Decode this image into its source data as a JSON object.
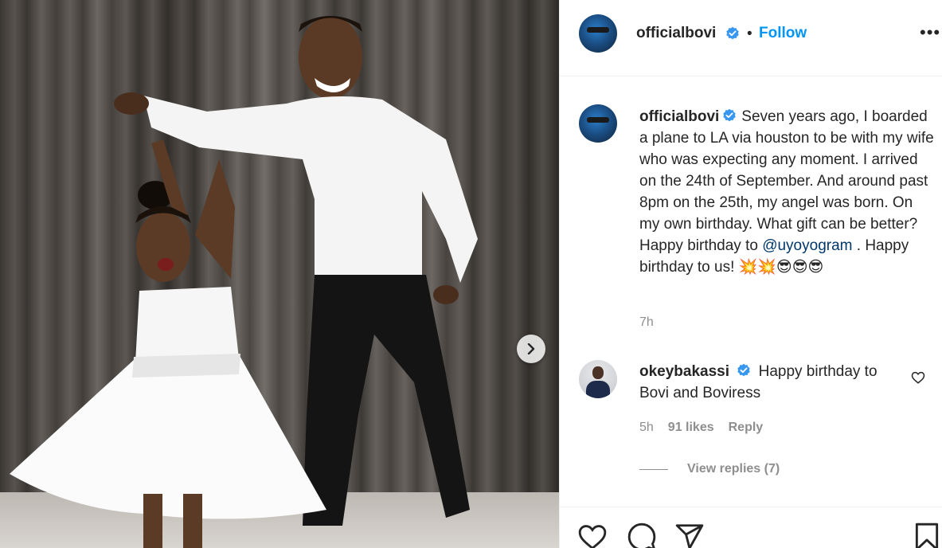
{
  "post": {
    "username": "officialbovi",
    "follow_label": "Follow",
    "dot": "•",
    "more_label": "•••"
  },
  "caption": {
    "username": "officialbovi",
    "text_before_mention": "Seven years ago, I boarded a plane to LA via houston to be with my wife who was expecting any moment. I arrived on the 24th of September. And around past 8pm on the 25th, my angel was born. On my own birthday. What gift can be better? Happy birthday to",
    "mention": "@uyoyogram",
    "text_after_mention": ". Happy birthday to us! 💥💥😎😎😎",
    "time": "7h"
  },
  "comment": {
    "username": "okeybakassi",
    "text": "Happy birthday to Bovi and Boviress",
    "time": "5h",
    "likes": "91 likes",
    "reply_label": "Reply",
    "view_replies": "View replies (7)"
  },
  "icons": {
    "like": "heart-icon",
    "comment": "comment-icon",
    "share": "paper-plane-icon",
    "save": "bookmark-icon",
    "next": "chevron-right-icon",
    "verified": "verified-badge-icon"
  },
  "colors": {
    "follow": "#0095f6",
    "mention": "#00376b",
    "verified": "#3897f0",
    "muted": "#8e8e8e"
  }
}
